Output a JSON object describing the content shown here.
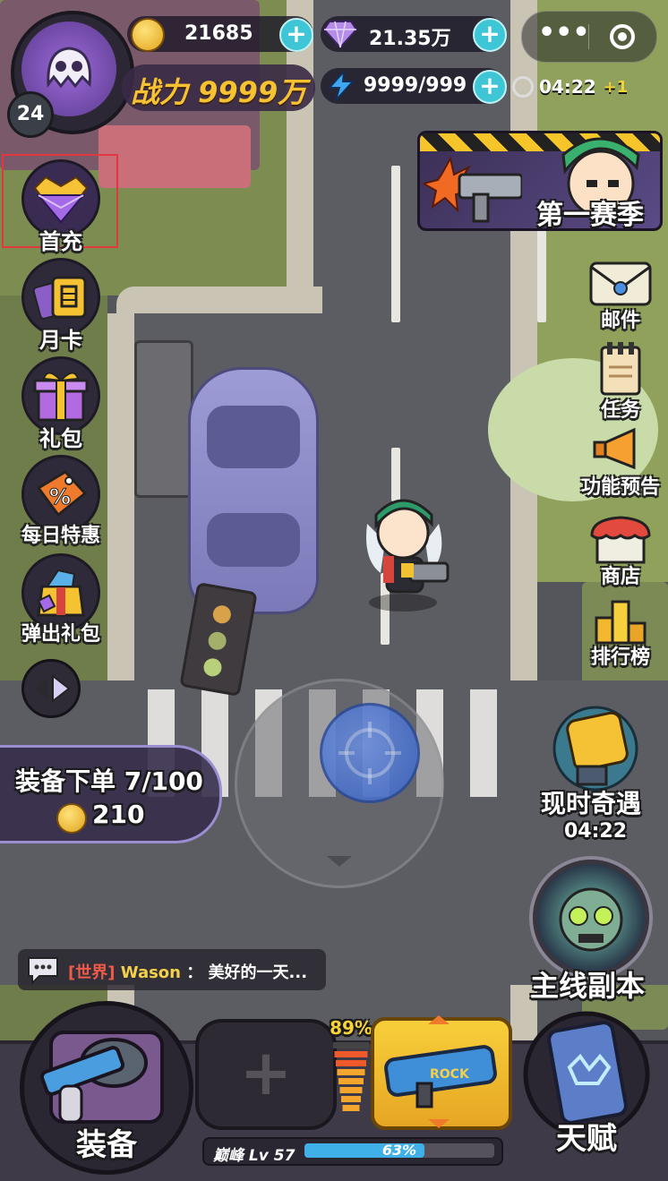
{
  "player": {
    "level": "24",
    "power_label": "战力 9999万"
  },
  "currency": {
    "gold": "21685",
    "gems": "21.35万",
    "energy": "9999/999",
    "timer": "04:22",
    "timer_bonus": "+1"
  },
  "season_banner": {
    "label": "第一赛季"
  },
  "left_menu": [
    {
      "key": "first-recharge",
      "label": "首充"
    },
    {
      "key": "monthly-card",
      "label": "月卡"
    },
    {
      "key": "gift-pack",
      "label": "礼包"
    },
    {
      "key": "daily-deal",
      "label": "每日特惠"
    },
    {
      "key": "popup-gift",
      "label": "弹出礼包"
    }
  ],
  "right_menu": [
    {
      "key": "mail",
      "label": "邮件"
    },
    {
      "key": "tasks",
      "label": "任务"
    },
    {
      "key": "feature-preview",
      "label": "功能预告"
    },
    {
      "key": "shop",
      "label": "商店"
    },
    {
      "key": "leaderboard",
      "label": "排行榜"
    }
  ],
  "order_panel": {
    "label": "装备下单 7/100",
    "coins": "210"
  },
  "encounter": {
    "label": "现时奇遇",
    "timer": "04:22"
  },
  "main_dungeon": {
    "label": "主线副本"
  },
  "chat": {
    "channel": "[世界]",
    "name": "Wason",
    "separator": "：",
    "message": "美好的一天..."
  },
  "bottom_bar": {
    "equipment_label": "装备",
    "talent_label": "天赋",
    "ammo_percent": "89%",
    "weapon_tag": "ROCK",
    "peak_label": "巅峰 Lv 57",
    "exp_percent_label": "63%",
    "exp_progress": 0.63,
    "ammo_progress": 0.89
  },
  "colors": {
    "highlight_box": "#e0383e",
    "plus_button": "#3ec6d6",
    "exp_bar": "#3fb0e8"
  }
}
